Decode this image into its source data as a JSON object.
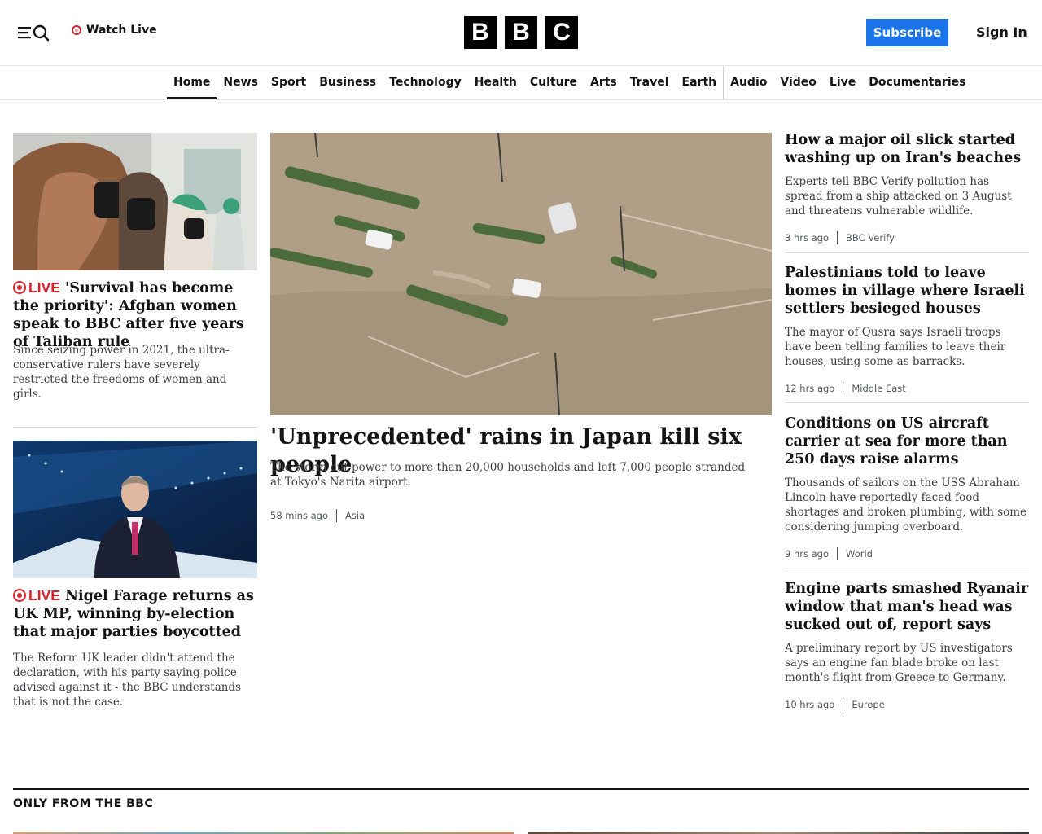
{
  "header": {
    "watch_live": "Watch Live",
    "logo_letters": [
      "B",
      "B",
      "C"
    ],
    "subscribe": "Subscribe",
    "sign_in": "Sign In"
  },
  "nav": {
    "items": [
      "Home",
      "News",
      "Sport",
      "Business",
      "Technology",
      "Health",
      "Culture",
      "Arts",
      "Travel",
      "Earth",
      "Audio",
      "Video",
      "Live",
      "Documentaries"
    ],
    "active": "Home"
  },
  "left": [
    {
      "live": "LIVE",
      "title": "'Survival has become the priority': Afghan women speak to BBC after five years of Taliban rule",
      "summary": "Since seizing power in 2021, the ultra-conservative rulers have severely restricted the freedoms of women and girls."
    },
    {
      "live": "LIVE",
      "title": "Nigel Farage returns as UK MP, winning by-election that major parties boycotted",
      "summary": "The Reform UK leader didn't attend the declaration, with his party saying police advised against it - the BBC understands that is not the case."
    }
  ],
  "main": {
    "title": "'Unprecedented' rains in Japan kill six people",
    "summary": "The storm cut power to more than 20,000 households and left 7,000 people stranded at Tokyo's Narita airport.",
    "time": "58 mins ago",
    "category": "Asia"
  },
  "right": [
    {
      "title": "How a major oil slick started washing up on Iran's beaches",
      "summary": "Experts tell BBC Verify pollution has spread from a ship attacked on 3 August and threatens vulnerable wildlife.",
      "time": "3 hrs ago",
      "category": "BBC Verify"
    },
    {
      "title": "Palestinians told to leave homes in village where Israeli settlers besieged houses",
      "summary": "The mayor of Qusra says Israeli troops have been telling families to leave their houses, using some as barracks.",
      "time": "12 hrs ago",
      "category": "Middle East"
    },
    {
      "title": "Conditions on US aircraft carrier at sea for more than 250 days raise alarms",
      "summary": "Thousands of sailors on the USS Abraham Lincoln have reportedly faced food shortages and broken plumbing, with some considering jumping overboard.",
      "time": "9 hrs ago",
      "category": "World"
    },
    {
      "title": "Engine parts smashed Ryanair window that man's head was sucked out of, report says",
      "summary": "A preliminary report by US investigators says an engine fan blade broke on last month's flight from Greece to Germany.",
      "time": "10 hrs ago",
      "category": "Europe"
    }
  ],
  "section": {
    "title": "ONLY FROM THE BBC"
  },
  "colors": {
    "live_red": "#d8232a",
    "subscribe_blue": "#1a73e8"
  },
  "icons": {
    "menu": "menu-icon",
    "search": "search-icon",
    "live": "live-dot-icon"
  }
}
